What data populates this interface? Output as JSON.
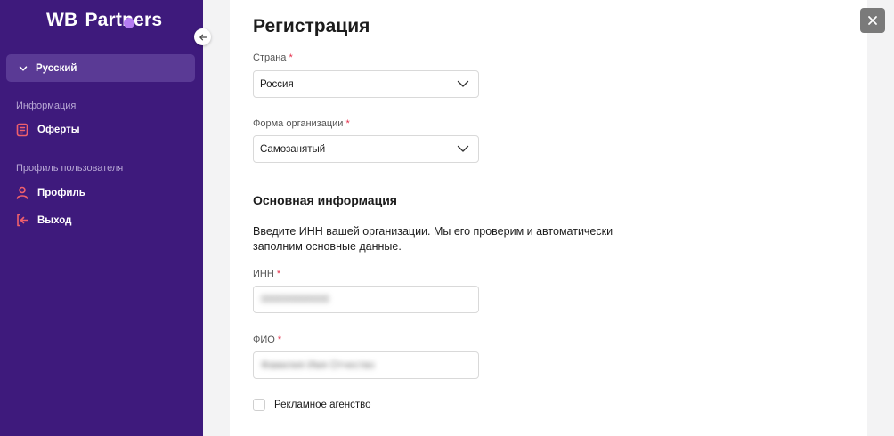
{
  "sidebar": {
    "logo": {
      "brand": "WB",
      "product": "Partners"
    },
    "language": {
      "label": "Русский"
    },
    "sections": [
      {
        "title": "Информация",
        "items": [
          {
            "label": "Оферты",
            "icon": "document-icon"
          }
        ]
      },
      {
        "title": "Профиль пользователя",
        "items": [
          {
            "label": "Профиль",
            "icon": "user-icon"
          },
          {
            "label": "Выход",
            "icon": "logout-icon"
          }
        ]
      }
    ]
  },
  "form": {
    "title": "Регистрация",
    "country": {
      "label": "Страна",
      "required_mark": "*",
      "value": "Россия"
    },
    "org_form": {
      "label": "Форма организации",
      "required_mark": "*",
      "value": "Самозанятый"
    },
    "basic_info": {
      "heading": "Основная информация",
      "description": "Введите ИНН вашей организации. Мы его проверим и автоматически заполним основные данные."
    },
    "inn": {
      "label": "ИНН",
      "required_mark": "*",
      "value": "000000000000"
    },
    "fio": {
      "label": "ФИО",
      "required_mark": "*",
      "value": "Фамилия Имя Отчество"
    },
    "ad_agency": {
      "label": "Рекламное агенство"
    }
  },
  "colors": {
    "sidebar_bg": "#3e1a7c",
    "accent": "#b57cf2",
    "icon_red": "#f0606c",
    "required": "#e5304c"
  }
}
